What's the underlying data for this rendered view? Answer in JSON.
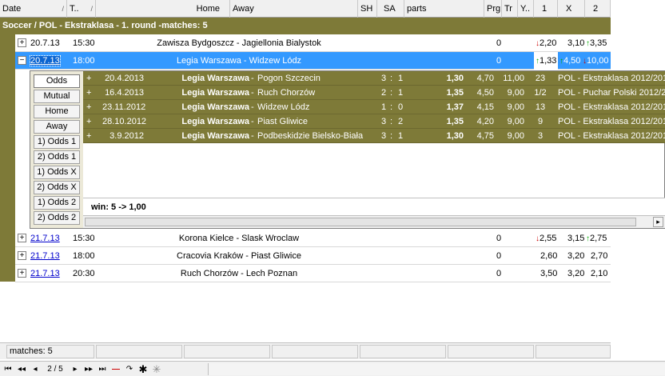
{
  "columns": [
    "Date",
    "T..",
    "Home",
    "Away",
    "SH",
    "SA",
    "parts",
    "Prg",
    "Tr",
    "Y..",
    "1",
    "X",
    "2"
  ],
  "group_title": "Soccer / POL - Ekstraklasa - 1. round -matches: 5",
  "matches": [
    {
      "date": "20.7.13",
      "time": "15:30",
      "home": "Zawisza Bydgoszcz",
      "away": "Jagiellonia Bialystok",
      "prg": "0",
      "o1": "2,20",
      "ox": "3,10",
      "o2": "3,35",
      "toggle": "+"
    },
    {
      "date": "20.7.13",
      "time": "18:00",
      "home": "Legia Warszawa",
      "away": "Widzew Lódz",
      "prg": "0",
      "o1": "1,33",
      "ox": "4,50",
      "o2": "10,00",
      "toggle": "−"
    },
    {
      "date": "21.7.13",
      "time": "15:30",
      "home": "Korona Kielce",
      "away": "Slask Wroclaw",
      "prg": "0",
      "o1": "2,55",
      "ox": "3,15",
      "o2": "2,75",
      "toggle": "+"
    },
    {
      "date": "21.7.13",
      "time": "18:00",
      "home": "Cracovia Kraków",
      "away": "Piast Gliwice",
      "prg": "0",
      "o1": "2,60",
      "ox": "3,20",
      "o2": "2,70",
      "toggle": "+"
    },
    {
      "date": "21.7.13",
      "time": "20:30",
      "home": "Ruch Chorzów",
      "away": "Lech Poznan",
      "prg": "0",
      "o1": "3,50",
      "ox": "3,20",
      "o2": "2,10",
      "toggle": "+"
    }
  ],
  "team_separator": "-",
  "side_buttons": [
    "Odds",
    "Mutual",
    "Home",
    "Away",
    "1) Odds 1",
    "2) Odds 1",
    "1) Odds X",
    "2) Odds X",
    "1) Odds 2",
    "2) Odds 2"
  ],
  "history": [
    {
      "plus": "+",
      "date": "20.4.2013",
      "home": "Legia Warszawa",
      "away": "Pogon Szczecin",
      "sh": "3",
      "sa": "1",
      "o1": "1,30",
      "ox": "4,70",
      "o2": "11,00",
      "round": "23",
      "league": "POL - Ekstraklasa 2012/2013"
    },
    {
      "plus": "+",
      "date": "16.4.2013",
      "home": "Legia Warszawa",
      "away": "Ruch Chorzów",
      "sh": "2",
      "sa": "1",
      "o1": "1,35",
      "ox": "4,50",
      "o2": "9,00",
      "round": "1/2",
      "league": "POL - Puchar Polski 2012/2013"
    },
    {
      "plus": "+",
      "date": "23.11.2012",
      "home": "Legia Warszawa",
      "away": "Widzew Lódz",
      "sh": "1",
      "sa": "0",
      "o1": "1,37",
      "ox": "4,15",
      "o2": "9,00",
      "round": "13",
      "league": "POL - Ekstraklasa 2012/2013"
    },
    {
      "plus": "+",
      "date": "28.10.2012",
      "home": "Legia Warszawa",
      "away": "Piast Gliwice",
      "sh": "3",
      "sa": "2",
      "o1": "1,35",
      "ox": "4,20",
      "o2": "9,00",
      "round": "9",
      "league": "POL - Ekstraklasa 2012/2013"
    },
    {
      "plus": "+",
      "date": "3.9.2012",
      "home": "Legia Warszawa",
      "away": "Podbeskidzie Bielsko-Biała",
      "sh": "3",
      "sa": "1",
      "o1": "1,30",
      "ox": "4,75",
      "o2": "9,00",
      "round": "3",
      "league": "POL - Ekstraklasa 2012/2013"
    }
  ],
  "score_separator": ":",
  "win_summary": "win: 5 -> 1,00",
  "status": {
    "matches": "matches: 5"
  },
  "navigator": {
    "page": "2 / 5"
  },
  "colors": {
    "group_bg": "#7e7a38",
    "selected_bg": "#3399ff",
    "up_arrow": "#00aa00",
    "down_arrow": "#cc0000"
  },
  "icons": [
    "first-icon",
    "prev-page-icon",
    "prev-icon",
    "next-icon",
    "next-page-icon",
    "last-icon",
    "delete-icon",
    "refresh-icon",
    "filter-icon",
    "clear-filter-icon"
  ]
}
